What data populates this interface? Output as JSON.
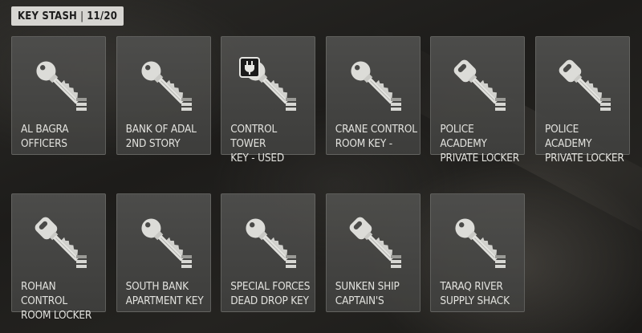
{
  "header": {
    "title": "KEY STASH",
    "separator": "|",
    "count": "11/20"
  },
  "keys": [
    {
      "label": "AL BAGRA\nOFFICERS",
      "icon": "key-icon",
      "style": "round"
    },
    {
      "label": "BANK OF ADAL\n2ND STORY",
      "icon": "key-icon",
      "style": "round"
    },
    {
      "label": "CONTROL TOWER\nKEY - USED",
      "icon": "key-icon",
      "style": "round",
      "badge": "plug-icon"
    },
    {
      "label": "CRANE CONTROL\nROOM KEY -",
      "icon": "key-icon",
      "style": "round"
    },
    {
      "label": "POLICE ACADEMY\nPRIVATE LOCKER",
      "icon": "key-icon",
      "style": "car"
    },
    {
      "label": "POLICE ACADEMY\nPRIVATE LOCKER",
      "icon": "key-icon",
      "style": "car"
    },
    {
      "label": "ROHAN CONTROL\nROOM LOCKER",
      "icon": "key-icon",
      "style": "car"
    },
    {
      "label": "SOUTH BANK\nAPARTMENT KEY",
      "icon": "key-icon",
      "style": "round"
    },
    {
      "label": "SPECIAL FORCES\nDEAD DROP KEY",
      "icon": "key-icon",
      "style": "round"
    },
    {
      "label": "SUNKEN SHIP\nCAPTAIN'S",
      "icon": "key-icon",
      "style": "car"
    },
    {
      "label": "TARAQ RIVER\nSUPPLY SHACK",
      "icon": "key-icon",
      "style": "round"
    }
  ]
}
